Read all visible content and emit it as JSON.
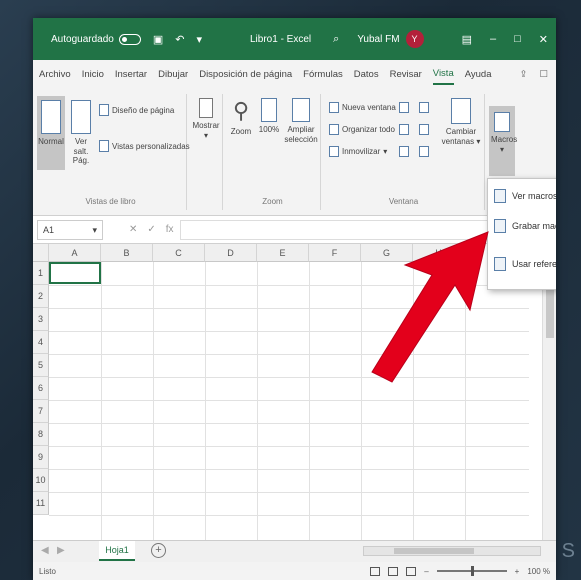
{
  "titlebar": {
    "autosave_label": "Autoguardado",
    "file_name": "Libro1 - Excel",
    "user_name": "Yubal FM",
    "avatar_initial": "Y"
  },
  "tabs": [
    "Archivo",
    "Inicio",
    "Insertar",
    "Dibujar",
    "Disposición de página",
    "Fórmulas",
    "Datos",
    "Revisar",
    "Vista",
    "Ayuda"
  ],
  "active_tab": "Vista",
  "ribbon": {
    "vistas_libro": {
      "normal": "Normal",
      "ver_salt": "Ver salt. Pág.",
      "diseno_pagina": "Diseño de página",
      "vistas_personalizadas": "Vistas personalizadas",
      "label": "Vistas de libro"
    },
    "mostrar": {
      "label": "Mostrar"
    },
    "zoom": {
      "zoom": "Zoom",
      "cien": "100%",
      "ampliar": "Ampliar selección",
      "label": "Zoom"
    },
    "ventana": {
      "nueva_ventana": "Nueva ventana",
      "organizar_todo": "Organizar todo",
      "inmovilizar": "Inmovilizar",
      "cambiar_ventanas": "Cambiar ventanas",
      "label": "Ventana"
    },
    "macros": {
      "label": "Macros"
    }
  },
  "macro_menu": {
    "items": [
      "Ver macros",
      "Grabar macro...",
      "Usar referencias relativas"
    ]
  },
  "formula_bar": {
    "name_box": "A1",
    "fx": "fx",
    "content": ""
  },
  "grid": {
    "columns": [
      "A",
      "B",
      "C",
      "D",
      "E",
      "F",
      "G",
      "H"
    ],
    "rows": [
      "1",
      "2",
      "3",
      "4",
      "5",
      "6",
      "7",
      "8",
      "9",
      "10",
      "11"
    ]
  },
  "sheet": {
    "tab": "Hoja1",
    "add": "+"
  },
  "status": {
    "left": "Listo",
    "zoom": "100 %"
  },
  "colors": {
    "accent": "#217346",
    "arrow": "#e3001b"
  }
}
